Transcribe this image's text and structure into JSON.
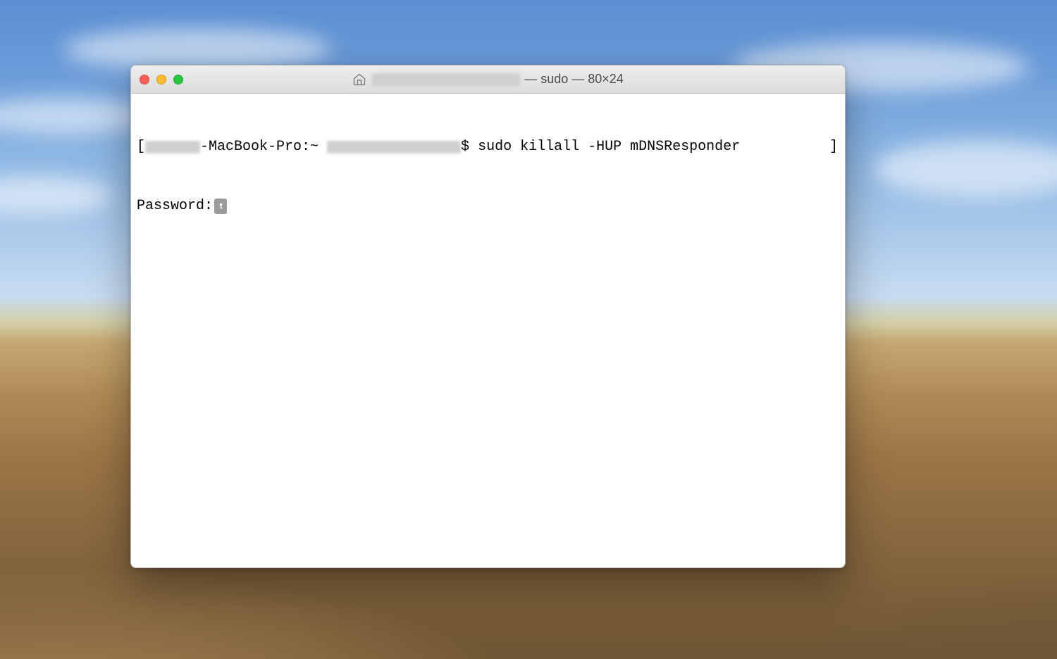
{
  "window": {
    "title_suffix": " — sudo — 80×24",
    "title_bar": {
      "close": "close",
      "minimize": "minimize",
      "zoom": "zoom"
    }
  },
  "terminal": {
    "line1": {
      "open_bracket": "[",
      "host_fragment": "-MacBook-Pro:~ ",
      "prompt_symbol": "$ ",
      "command": "sudo killall -HUP mDNSResponder",
      "close_bracket": "]"
    },
    "line2": {
      "label": "Password:"
    }
  }
}
